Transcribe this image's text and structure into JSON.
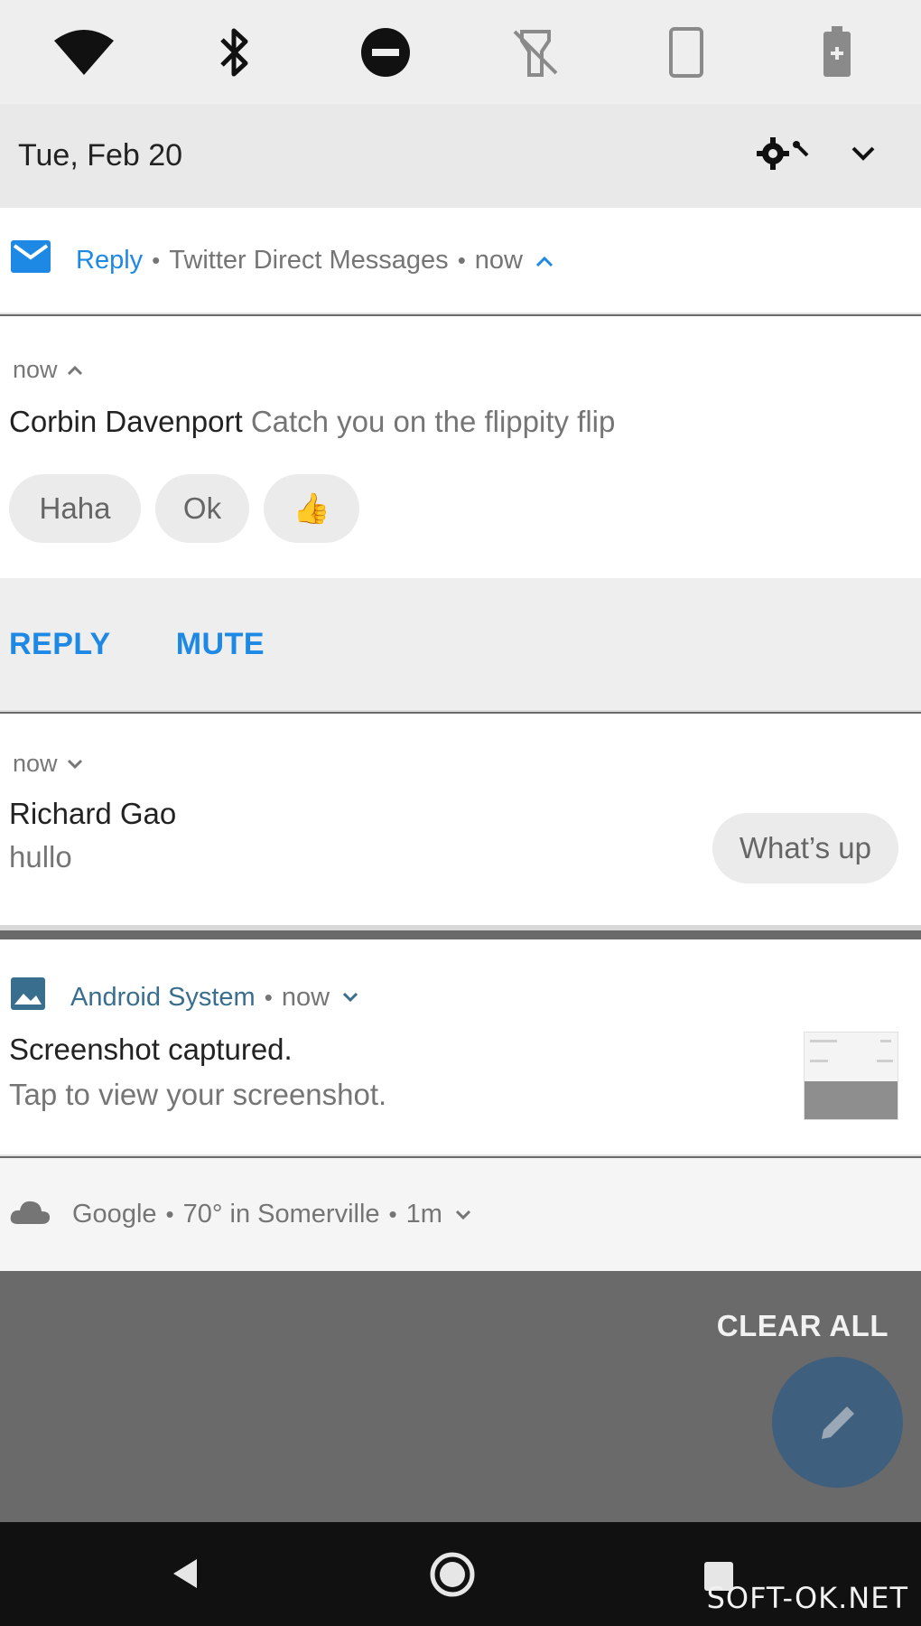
{
  "quick_settings": {
    "tiles": [
      "wifi-icon",
      "bluetooth-icon",
      "do-not-disturb-icon",
      "flashlight-off-icon",
      "auto-rotate-icon",
      "battery-saver-icon"
    ],
    "date": "Tue, Feb 20"
  },
  "notifications": {
    "twitter": {
      "app_name": "Reply",
      "channel": "Twitter Direct Messages",
      "time": "now",
      "messages": [
        {
          "time": "now",
          "sender": "Corbin Davenport",
          "text": "Catch you on the flippity flip",
          "smart_replies": [
            "Haha",
            "Ok",
            "👍"
          ]
        },
        {
          "time": "now",
          "sender": "Richard Gao",
          "text": "hullo",
          "smart_reply": "What’s up"
        }
      ],
      "actions": [
        "REPLY",
        "MUTE"
      ]
    },
    "screenshot": {
      "app_name": "Android System",
      "time": "now",
      "title": "Screenshot captured.",
      "body": "Tap to view your screenshot."
    },
    "weather": {
      "app_name": "Google",
      "summary": "70° in Somerville",
      "time": "1m"
    }
  },
  "clear_all": "CLEAR ALL",
  "watermark": "SOFT-OK.NET",
  "colors": {
    "accent": "#1e88e5",
    "fab": "#3f5f7f",
    "navbar": "#111111"
  }
}
